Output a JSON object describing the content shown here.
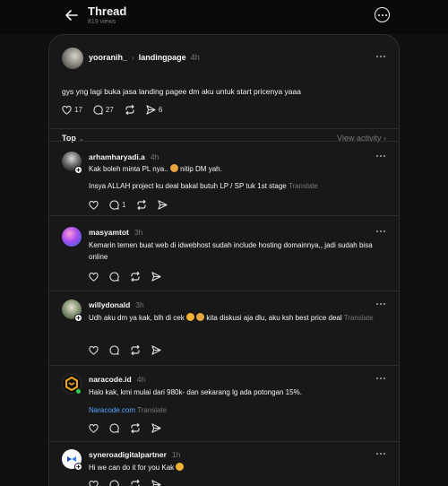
{
  "header": {
    "title": "Thread",
    "views": "819 views"
  },
  "post": {
    "username": "yooranih_",
    "tagged": "landingpage",
    "time": "4h",
    "text": "gys yng lagi buka jasa landing pagee dm aku untuk start pricenya yaaa",
    "likes": "17",
    "comments": "27",
    "shares": "6"
  },
  "sort": {
    "label": "Top",
    "view_activity": "View activity"
  },
  "replies": [
    {
      "username": "arhamharyadi.a",
      "time": "4h",
      "line1": "Kak boleh minta PL nya..",
      "line1b": "nitip DM yah.",
      "line2": "Insya ALLAH project ku deal bakal butuh LP / SP tuk 1st stage",
      "translate": "Translate",
      "comments": "1"
    },
    {
      "username": "masyamtot",
      "time": "3h",
      "text": "Kemarin temen buat web di idwebhost sudah include hosting domainnya,, jadi sudah bisa online"
    },
    {
      "username": "willydonald",
      "time": "3h",
      "text1": "Udh aku dm ya kak, blh di cek",
      "text2": "kita diskusi aja dlu, aku ksh best price",
      "text3": "deal",
      "translate": "Translate"
    },
    {
      "username": "naracode.id",
      "time": "4h",
      "text": "Halo kak, kmi mulai dari 980k- dan sekarang lg ada potongan 15%.",
      "link": "Naracode.com",
      "translate": "Translate"
    },
    {
      "username": "syneroadigitalpartner",
      "time": "1h",
      "text": "Hi we can do it for you Kak"
    }
  ],
  "colors": {
    "background": "#101010",
    "panel": "#181818",
    "border": "#2d2d2d",
    "link": "#5aa7ff",
    "online": "#2ec94e"
  }
}
